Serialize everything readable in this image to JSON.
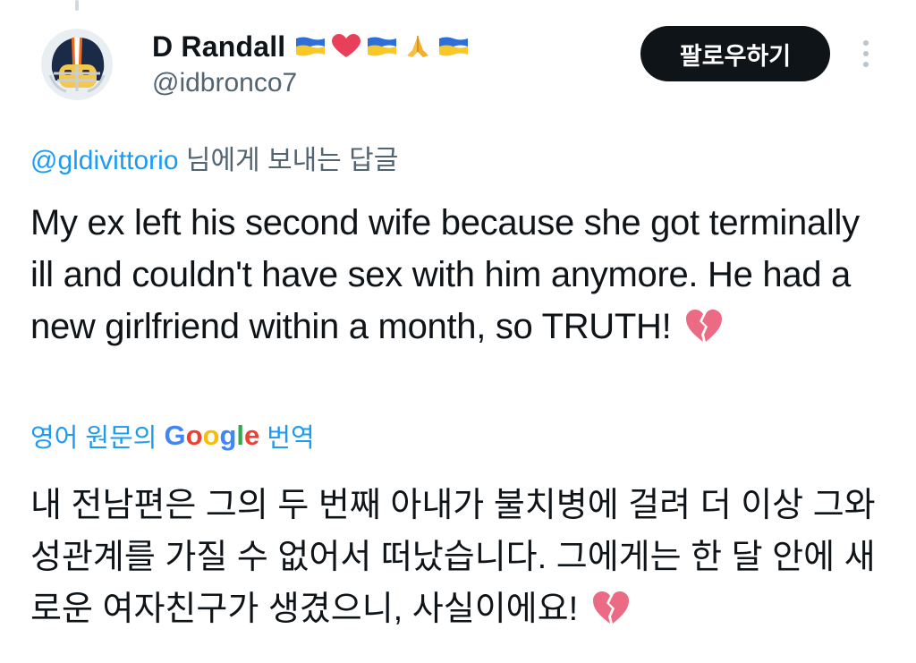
{
  "tweet": {
    "author": {
      "display_name": "D Randall",
      "handle": "@idbronco7",
      "name_emojis": [
        "ukraine-flag",
        "red-heart",
        "ukraine-flag",
        "folded-hands",
        "ukraine-flag"
      ],
      "avatar": "broncos-football-helmet-avatar"
    },
    "follow_label": "팔로우하기",
    "reply_context": {
      "mention": "@gldivittorio",
      "suffix": " 님에게 보내는 답글"
    },
    "text": "My ex left his second wife because she got terminally ill and couldn't have sex with him anymore. He had a new girlfriend within a month, so TRUTH!",
    "text_emoji": "broken-heart",
    "translation": {
      "prefix": "영어 원문의",
      "google_logo": "Google",
      "suffix": "번역",
      "text": "내 전남편은 그의 두 번째 아내가 불치병에 걸려 더 이상 그와 성관계를 가질 수 없어서 떠났습니다. 그에게는 한 달 안에 새로운 여자친구가 생겼으니, 사실이에요!",
      "text_emoji": "broken-heart"
    }
  },
  "colors": {
    "text_primary": "#0f1419",
    "text_secondary": "#536471",
    "link_blue": "#1d9bf0",
    "button_bg": "#0f1419",
    "broken_heart": "#e8637a"
  }
}
